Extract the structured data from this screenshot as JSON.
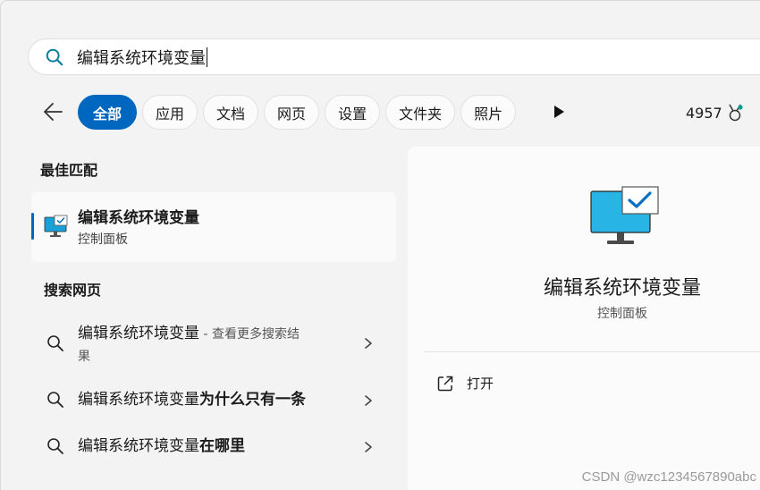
{
  "search": {
    "query": "编辑系统环境变量",
    "icon": "search-icon"
  },
  "filters": {
    "back_icon": "back-arrow-icon",
    "chips": [
      "全部",
      "应用",
      "文档",
      "网页",
      "设置",
      "文件夹",
      "照片"
    ],
    "active_chip": "全部",
    "more_icon": "play-more-icon",
    "points": "4957",
    "points_icon": "rewards-medal-icon"
  },
  "best_match": {
    "header": "最佳匹配",
    "name": "编辑系统环境变量",
    "subtitle": "控制面板",
    "icon": "control-panel-monitor-icon"
  },
  "web_search": {
    "header": "搜索网页",
    "items": [
      {
        "main": "编辑系统环境变量",
        "extra": " - 查看更多搜索结",
        "wrap": "果"
      },
      {
        "main": "编辑系统环境变量",
        "bold": "为什么只有一条"
      },
      {
        "main": "编辑系统环境变量",
        "bold": "在哪里"
      }
    ]
  },
  "preview": {
    "title": "编辑系统环境变量",
    "subtitle": "控制面板",
    "action_label": "打开",
    "action_icon": "open-external-icon"
  },
  "watermark": "CSDN @wzc1234567890abc",
  "colors": {
    "accent": "#0067c0",
    "background": "#f3f3f3",
    "panel": "#fbfbfb"
  }
}
